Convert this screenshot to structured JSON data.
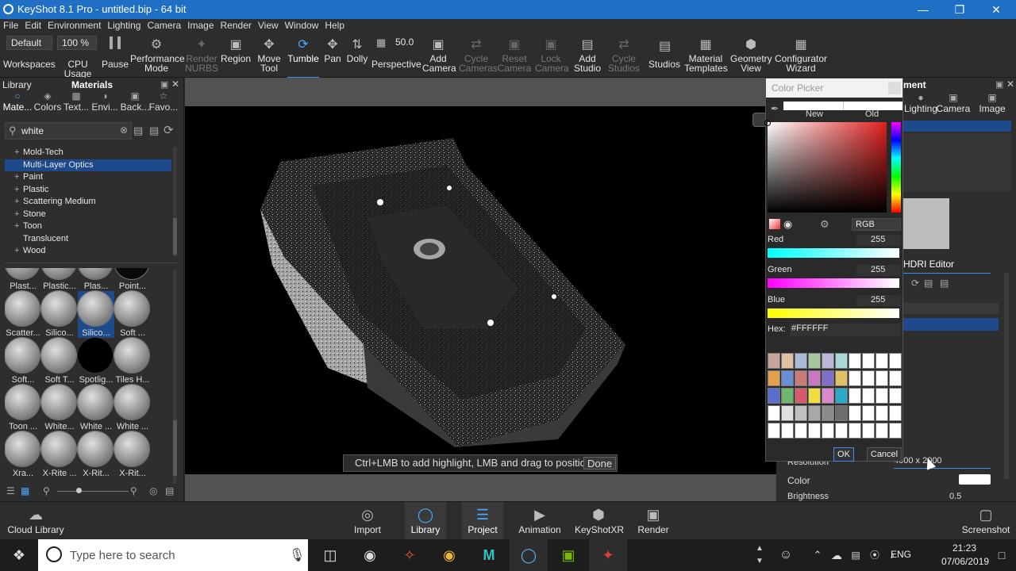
{
  "app": {
    "title": "KeyShot 8.1 Pro  -  untitled.bip  -  64 bit"
  },
  "menu": [
    "File",
    "Edit",
    "Environment",
    "Lighting",
    "Camera",
    "Image",
    "Render",
    "View",
    "Window",
    "Help"
  ],
  "toolbar": {
    "preset": "Default",
    "zoom": "100 %",
    "fov": "50.0",
    "items": [
      "Workspaces",
      "CPU Usage",
      "Pause",
      "Performance Mode",
      "Render NURBS",
      "Region",
      "Move Tool",
      "Tumble",
      "Pan",
      "Dolly",
      "Perspective",
      "Add Camera",
      "Cycle Cameras",
      "Reset Camera",
      "Lock Camera",
      "Add Studio",
      "Cycle Studios",
      "Studios",
      "Material Templates",
      "Geometry View",
      "Configurator Wizard"
    ]
  },
  "library": {
    "header": "Library",
    "title": "Materials",
    "tabs": [
      "Mate...",
      "Colors",
      "Text...",
      "Envi...",
      "Back...",
      "Favo..."
    ],
    "search": "white",
    "tree": [
      "Mold-Tech",
      "Multi-Layer Optics",
      "Paint",
      "Plastic",
      "Scattering Medium",
      "Stone",
      "Toon",
      "Translucent",
      "Wood"
    ],
    "thumbs": [
      "Plast...",
      "Plastic...",
      "Plas...",
      "Point...",
      "Scatter...",
      "Silico...",
      "Silico...",
      "Soft ...",
      "Soft...",
      "Soft T...",
      "Spotlig...",
      "Tiles H...",
      "Toon ...",
      "White...",
      "White ...",
      "White ...",
      "Xra...",
      "X-Rite ...",
      "X-Rit...",
      "X-Rit..."
    ]
  },
  "viewport": {
    "hint": "Ctrl+LMB to add highlight, LMB and drag to position",
    "done": "Done"
  },
  "right_panel": {
    "title": "ment",
    "tabs": [
      "Lighting",
      "Camera",
      "Image"
    ],
    "hdri": "HDRI Editor",
    "resolution_label": "Resolution",
    "resolution_value": "4000 x 2000",
    "color_label": "Color",
    "brightness_label": "Brightness",
    "brightness_value": "0.5"
  },
  "color_picker": {
    "title": "Color Picker",
    "new": "New",
    "old": "Old",
    "mode": "RGB",
    "red_label": "Red",
    "red": "255",
    "green_label": "Green",
    "green": "255",
    "blue_label": "Blue",
    "blue": "255",
    "hex_label": "Hex:",
    "hex": "#FFFFFF",
    "ok": "OK",
    "cancel": "Cancel",
    "swatches": [
      "#c9a49a",
      "#e1c0a4",
      "#a9bcd6",
      "#a8c7a0",
      "#b8b8d8",
      "#a8d8d8",
      "#ffffff",
      "#ffffff",
      "#ffffff",
      "#ffffff",
      "#e3a04a",
      "#6b8fd4",
      "#c97a7a",
      "#c878c0",
      "#7f6fc8",
      "#e0c060",
      "#ffffff",
      "#ffffff",
      "#ffffff",
      "#ffffff",
      "#5a6ed0",
      "#6fb66f",
      "#d55a6a",
      "#f0de40",
      "#d88ac8",
      "#2ba9c9",
      "#ffffff",
      "#ffffff",
      "#ffffff",
      "#ffffff",
      "#ffffff",
      "#e0e0e0",
      "#c0c0c0",
      "#a8a8a8",
      "#8c8c8c",
      "#6e6e6e",
      "#ffffff",
      "#ffffff",
      "#ffffff",
      "#ffffff",
      "#ffffff",
      "#ffffff",
      "#ffffff",
      "#ffffff",
      "#ffffff",
      "#ffffff",
      "#ffffff",
      "#ffffff",
      "#ffffff",
      "#ffffff"
    ]
  },
  "bottom": {
    "cloud": "Cloud Library",
    "tabs": [
      "Import",
      "Library",
      "Project",
      "Animation",
      "KeyShotXR",
      "Render"
    ],
    "screenshot": "Screenshot"
  },
  "taskbar": {
    "search": "Type here to search",
    "lang": "ENG",
    "time": "21:23",
    "date": "07/06/2019"
  }
}
